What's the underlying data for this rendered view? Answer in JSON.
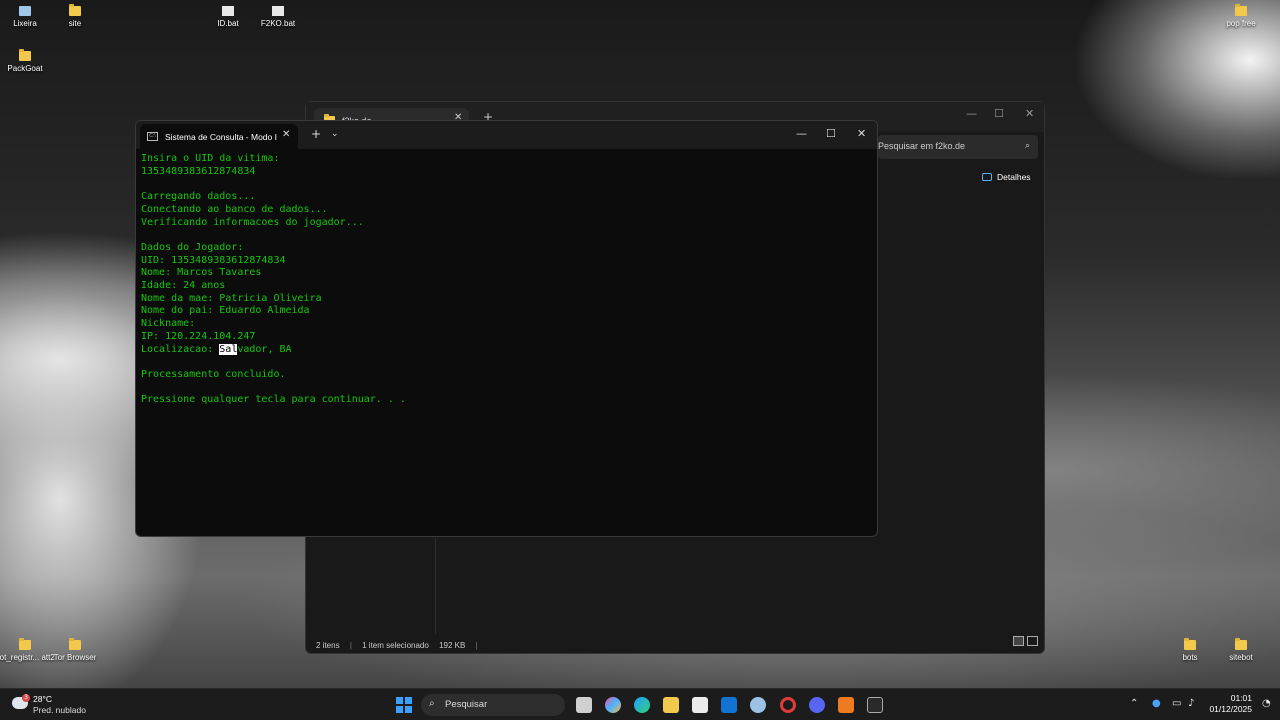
{
  "desktop": {
    "icons": [
      {
        "label": "Lixeira"
      },
      {
        "label": "site"
      },
      {
        "label": "ID.bat"
      },
      {
        "label": "F2KO.bat"
      },
      {
        "label": "PackGoat"
      },
      {
        "label": "pop free"
      },
      {
        "label": "bot_registr... att2"
      },
      {
        "label": "Tor Browser"
      },
      {
        "label": "bots"
      },
      {
        "label": "sitebot"
      }
    ]
  },
  "explorer": {
    "tab_title": "f2ko.de",
    "search_placeholder": "Pesquisar em f2ko.de",
    "details_label": "Detalhes",
    "status": {
      "items": "2 itens",
      "selected": "1 item selecionado",
      "size": "192 KB"
    }
  },
  "terminal": {
    "tab_title": "Sistema de Consulta - Modo I",
    "lines": [
      "Insira o UID da vitima:",
      "1353489383612874834",
      "",
      "Carregando dados...",
      "Conectando ao banco de dados...",
      "Verificando informacoes do jogador...",
      "",
      "Dados do Jogador:",
      "UID: 1353489383612874834",
      "Nome: Marcos Tavares",
      "Idade: 24 anos",
      "Nome da mae: Patricia Oliveira",
      "Nome do pai: Eduardo Almeida",
      "Nickname:",
      "IP: 120.224.104.247",
      "",
      "",
      "Processamento concluido.",
      "",
      "Pressione qualquer tecla para continuar. . ."
    ],
    "location_prefix": "Localizacao: ",
    "location_selected": "Sal",
    "location_rest": "vador, BA"
  },
  "taskbar": {
    "weather_temp": "28°C",
    "weather_condition": "Pred. nublado",
    "weather_badge": "3",
    "search_label": "Pesquisar",
    "time": "01:01",
    "date": "01/12/2025"
  }
}
